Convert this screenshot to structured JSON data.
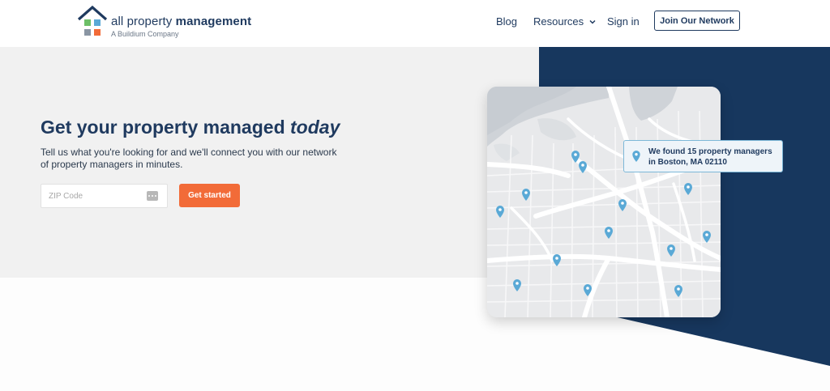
{
  "brand": {
    "name_regular": "all property ",
    "name_bold": "management",
    "tagline": "A Buildium Company",
    "colors": {
      "navy": "#1f3a5f",
      "orange": "#f26b38",
      "blue": "#5aa9d6",
      "green": "#6dbf67",
      "gray": "#8a95a3"
    }
  },
  "nav": {
    "blog": "Blog",
    "resources": "Resources",
    "signin": "Sign in",
    "join": "Join Our Network"
  },
  "hero": {
    "title_prefix": "Get your property managed ",
    "title_emphasis": "today",
    "description": "Tell us what you're looking for and we'll connect you with our network of property managers in minutes.",
    "zip_placeholder": "ZIP Code",
    "zip_value": "",
    "cta": "Get started"
  },
  "map": {
    "callout": "We found 15 property managers in Boston, MA 02110",
    "pin_icon": "map-pin-icon"
  }
}
